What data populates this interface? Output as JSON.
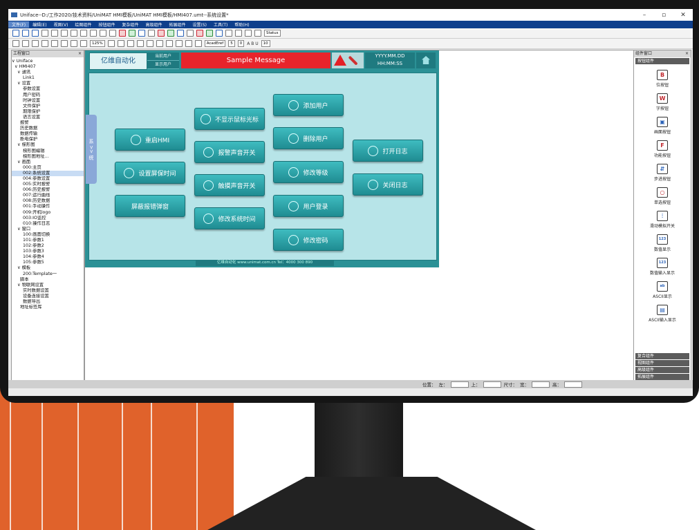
{
  "window": {
    "title": "Uniface--D:/工作2020/技术资料/UniMAT HMI模板/UniMAT HMI模板/HMI407.umt--系统设置*"
  },
  "menu": [
    "文件(F)",
    "编辑(E)",
    "视图(V)",
    "绘图组件",
    "按钮组件",
    "复杂组件",
    "高级组件",
    "拓展组件",
    "设置(S)",
    "工具(T)",
    "帮助(H)"
  ],
  "toolbar": {
    "zoom": "125%",
    "font": "AcadEref",
    "fontsize": "5",
    "linewidth": "0",
    "status": "Status",
    "sizeval": "10"
  },
  "left_panel": {
    "title": "工程窗口",
    "tree": [
      "∨ Uniface",
      "  ∨ HMI407",
      "    ∨ 通讯",
      "        Link1",
      "    ∨ 设置",
      "        参数设置",
      "        用户密码",
      "        时钟设置",
      "        文件保护",
      "        期限保护",
      "        语言设置",
      "      报警",
      "      历史数据",
      "      数据传输",
      "      断电保护",
      "    ∨ 梯形图",
      "        梯形图编辑",
      "        梯形图地址…",
      "    ∨ 画面",
      "        000:主页",
      "        002:系统设置",
      "        004:参数设置",
      "        005:实时报警",
      "        006:历史报警",
      "        007:运行曲线",
      "        008:历史数据",
      "        001:手动操作",
      "        009:开机logo",
      "        003:IO监控",
      "        010:操作日志",
      "    ∨ 窗口",
      "        100:画面切换",
      "        101:参数1",
      "        102:参数2",
      "        103:参数3",
      "        104:参数4",
      "        105:参数5",
      "    ∨ 模板",
      "        200:Template一",
      "      脚本",
      "    ∨ 物联网设置",
      "        实时数据设置",
      "        设备连接设置",
      "        数据导出",
      "      地址标签库"
    ],
    "selected_index": 20
  },
  "hmi": {
    "brand": "亿维自动化",
    "current_user": "当前用户",
    "show_user": "显示用户",
    "message": "Sample Message",
    "date": "YYYY.MM.DD",
    "time": "HH:MM:SS",
    "side_tab": "系 >> 统",
    "buttons": {
      "restart": "重启HMI",
      "screensaver": "设置屏保时间",
      "block_popup": "屏蔽报错弹窗",
      "hide_cursor": "不显示鼠标光标",
      "alarm_sound": "报警声音开关",
      "touch_sound": "触摸声音开关",
      "sys_time": "修改系统时间",
      "add_user": "添加用户",
      "del_user": "删除用户",
      "mod_level": "修改等级",
      "login": "用户登录",
      "mod_pwd": "修改密码",
      "open_log": "打开日志",
      "close_log": "关闭日志"
    },
    "footer": "亿维自动化 www.unimat.com.cn  Tel：4000 300 890"
  },
  "right_panel": {
    "title": "组件窗口",
    "section": "按钮组件",
    "components": [
      "位按钮",
      "字按钮",
      "画面按钮",
      "功能按钮",
      "步进按钮",
      "单选按钮",
      "滑动模拟开关",
      "数值显示",
      "数值输入显示",
      "ASCII显示",
      "ASCII输入显示"
    ],
    "categories": [
      "复合组件",
      "视图组件",
      "高级组件",
      "拓展组件"
    ]
  },
  "statusbar": {
    "pos": "位置：",
    "left": "左：",
    "top": "上：",
    "size": "尺寸：",
    "width": "宽：",
    "height": "高："
  },
  "colors": {
    "accent": "#2b9196",
    "alarm": "#e8242b",
    "menubar": "#0e3f8c",
    "background": "#e0622b"
  }
}
